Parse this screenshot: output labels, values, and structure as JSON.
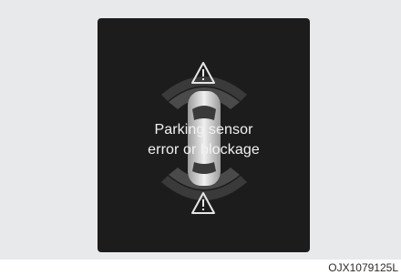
{
  "display": {
    "message_line1": "Parking sensor",
    "message_line2": "error or blockage"
  },
  "figure_code": "OJX1079125L",
  "icons": {
    "top_warning": "warning-triangle-icon",
    "bottom_warning": "warning-triangle-icon",
    "vehicle": "car-top-view-icon"
  },
  "colors": {
    "screen_bg": "#1c1c1c",
    "outer_bg": "#e8e9ea",
    "text": "#f2f2f2"
  }
}
